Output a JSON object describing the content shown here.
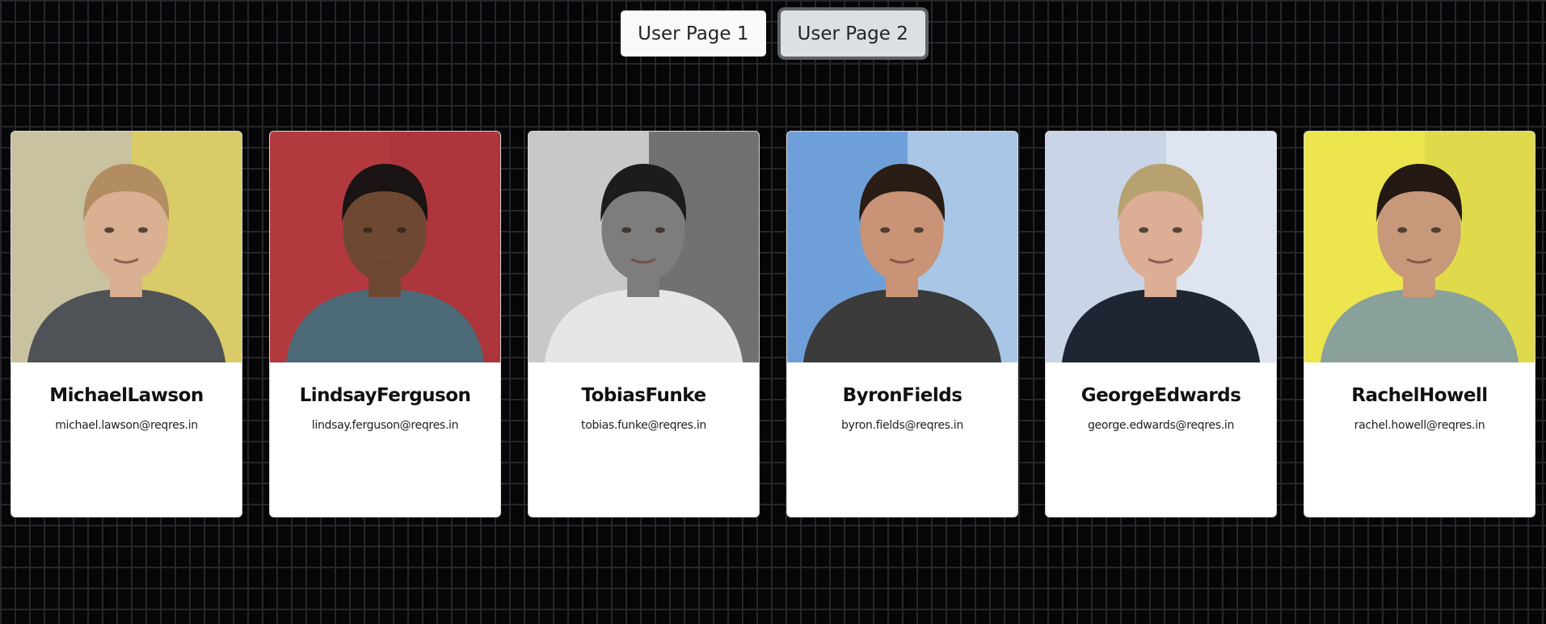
{
  "nav": {
    "page1_label": "User Page 1",
    "page2_label": "User Page 2",
    "active": "page2"
  },
  "users": [
    {
      "name": "MichaelLawson",
      "email": "michael.lawson@reqres.in",
      "photo": {
        "bg": "#c9c2a0",
        "accent": "#e3d43a",
        "skin": "#d9b092",
        "hair": "#b38d62",
        "shirt": "#4f5257"
      }
    },
    {
      "name": "LindsayFerguson",
      "email": "lindsay.ferguson@reqres.in",
      "photo": {
        "bg": "#b23a3f",
        "accent": "#a83338",
        "skin": "#6e4832",
        "hair": "#1a1414",
        "shirt": "#4d6a78"
      }
    },
    {
      "name": "TobiasFunke",
      "email": "tobias.funke@reqres.in",
      "photo": {
        "bg": "#c8c8c8",
        "accent": "#2a2a2a",
        "skin": "#7d7d7d",
        "hair": "#1c1c1c",
        "shirt": "#e6e6e6"
      }
    },
    {
      "name": "ByronFields",
      "email": "byron.fields@reqres.in",
      "photo": {
        "bg": "#6f9fd8",
        "accent": "#d9e6f2",
        "skin": "#c99377",
        "hair": "#2a1d16",
        "shirt": "#3b3b3b"
      }
    },
    {
      "name": "GeorgeEdwards",
      "email": "george.edwards@reqres.in",
      "photo": {
        "bg": "#c9d4e6",
        "accent": "#eef2f8",
        "skin": "#dcae96",
        "hair": "#b8a170",
        "shirt": "#1f2633"
      }
    },
    {
      "name": "RachelHowell",
      "email": "rachel.howell@reqres.in",
      "photo": {
        "bg": "#ece54e",
        "accent": "#d6d148",
        "skin": "#c8987a",
        "hair": "#231814",
        "shirt": "#8aa09a"
      }
    }
  ]
}
